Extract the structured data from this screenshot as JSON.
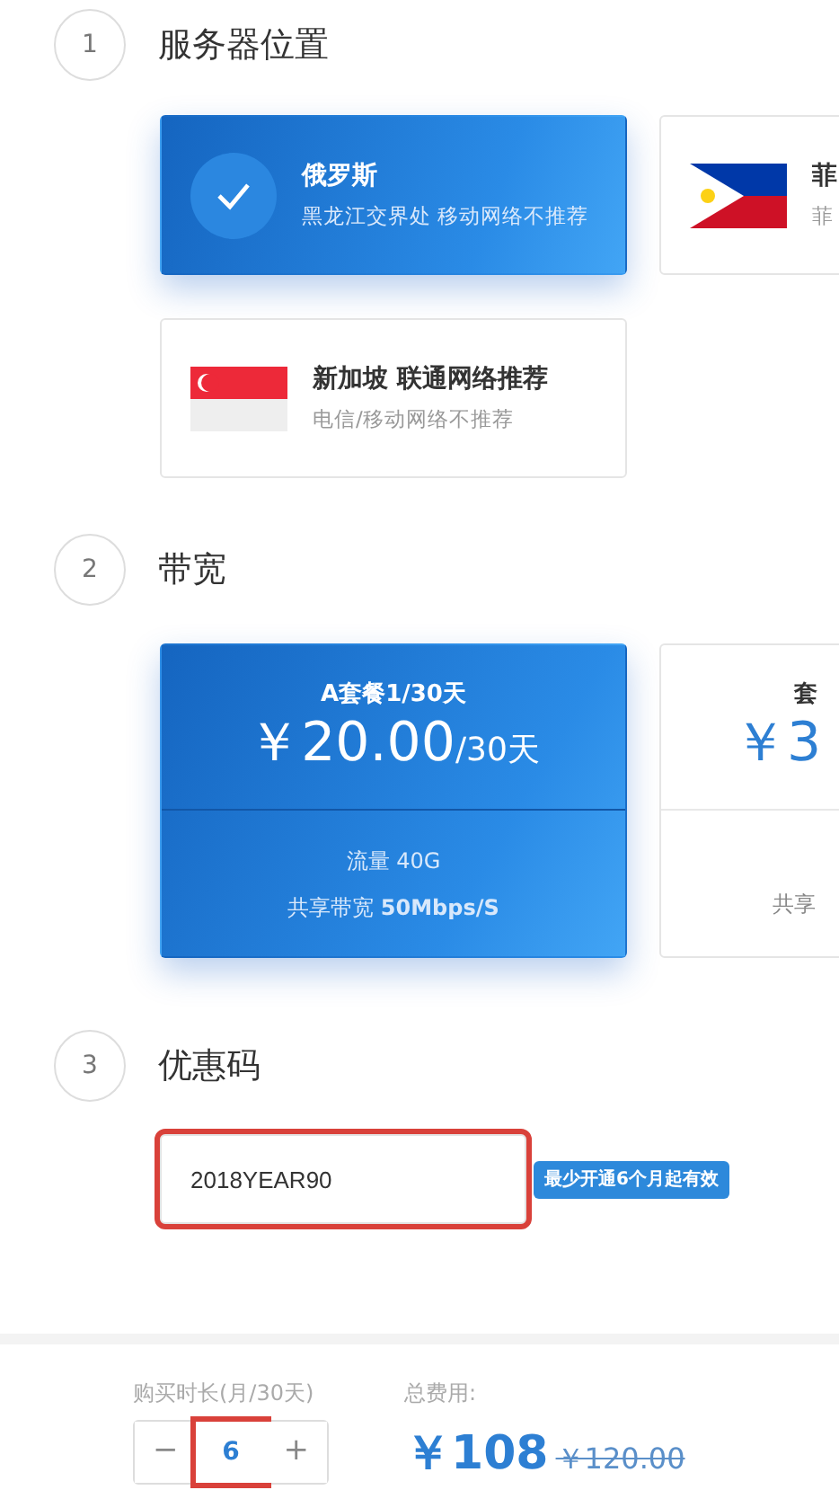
{
  "steps": [
    {
      "number": "1",
      "title": "服务器位置",
      "kind": "locations",
      "items": [
        {
          "name": "俄罗斯",
          "desc": "黑龙江交界处 移动网络不推荐",
          "selected": true,
          "kind": "check"
        },
        {
          "name": "菲",
          "desc": "菲",
          "selected": false,
          "kind": "flag-ph"
        },
        {
          "name": "新加坡 联通网络推荐",
          "desc": "电信/移动网络不推荐",
          "selected": false,
          "kind": "flag-sg"
        }
      ]
    },
    {
      "number": "2",
      "title": "带宽",
      "kind": "plans",
      "items": [
        {
          "name": "A套餐1/30天",
          "price": "￥20.00",
          "unit": "/30天",
          "traffic": "流量 40G",
          "bandwidth": "共享带宽 **50Mbps/S**",
          "selected": true
        },
        {
          "name": "套",
          "price": "￥3",
          "bandwidth": "共享",
          "selected": false
        }
      ]
    },
    {
      "number": "3",
      "title": "优惠码",
      "kind": "coupon",
      "value": "2018YEAR90",
      "highlighted": true,
      "note": "最少开通6个月起有效"
    }
  ],
  "footer": {
    "duration_label": "购买时长(月/30天)",
    "minus": "−",
    "quantity": "6",
    "plus": "+",
    "quantity_highlighted": true,
    "total_label": "总费用:",
    "total": "￥108",
    "original": "￥120.00"
  }
}
